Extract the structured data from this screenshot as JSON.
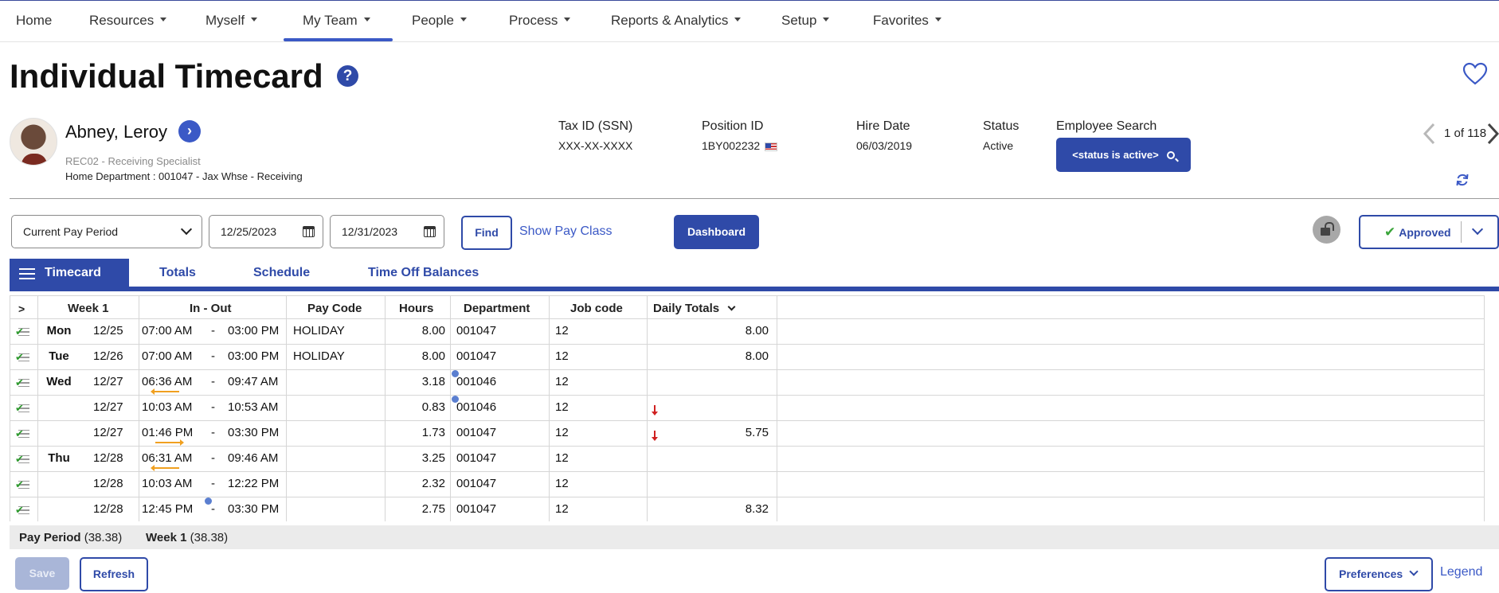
{
  "nav": {
    "items": [
      {
        "label": "Home",
        "dropdown": false
      },
      {
        "label": "Resources",
        "dropdown": true
      },
      {
        "label": "Myself",
        "dropdown": true
      },
      {
        "label": "My Team",
        "dropdown": true,
        "active": true
      },
      {
        "label": "People",
        "dropdown": true
      },
      {
        "label": "Process",
        "dropdown": true
      },
      {
        "label": "Reports & Analytics",
        "dropdown": true
      },
      {
        "label": "Setup",
        "dropdown": true
      },
      {
        "label": "Favorites",
        "dropdown": true
      }
    ]
  },
  "page": {
    "title": "Individual Timecard",
    "help_icon": "?"
  },
  "employee": {
    "name": "Abney, Leroy",
    "go_icon": "›",
    "position": "REC02 - Receiving Specialist",
    "home_department": "Home Department : 001047 - Jax Whse - Receiving",
    "tax_id_label": "Tax ID (SSN)",
    "tax_id_value": "XXX-XX-XXXX",
    "position_id_label": "Position ID",
    "position_id_value": "1BY002232",
    "hire_date_label": "Hire Date",
    "hire_date_value": "06/03/2019",
    "status_label": "Status",
    "status_value": "Active",
    "search_label": "Employee Search",
    "search_button": "<status is active>",
    "pager": "1 of 118"
  },
  "filters": {
    "period": "Current Pay Period",
    "start_date": "12/25/2023",
    "end_date": "12/31/2023",
    "find": "Find",
    "show_pay_class": "Show Pay Class",
    "dashboard": "Dashboard",
    "approved": "Approved"
  },
  "tabs": {
    "timecard": "Timecard",
    "totals": "Totals",
    "schedule": "Schedule",
    "time_off_balances": "Time Off Balances"
  },
  "table": {
    "headers": {
      "expand": ">",
      "week": "Week 1",
      "in_out": "In - Out",
      "pay_code": "Pay Code",
      "hours": "Hours",
      "department": "Department",
      "job_code": "Job code",
      "daily_totals": "Daily Totals"
    },
    "rows": [
      {
        "day": "Mon",
        "date": "12/25",
        "in": "07:00 AM",
        "sep": "-",
        "out": "03:00 PM",
        "pay_code": "HOLIDAY",
        "hours": "8.00",
        "department": "001047",
        "job_code": "12",
        "daily_total": "8.00"
      },
      {
        "day": "Tue",
        "date": "12/26",
        "in": "07:00 AM",
        "sep": "-",
        "out": "03:00 PM",
        "pay_code": "HOLIDAY",
        "hours": "8.00",
        "department": "001047",
        "job_code": "12",
        "daily_total": "8.00"
      },
      {
        "day": "Wed",
        "date": "12/27",
        "in": "06:36 AM",
        "sep": "-",
        "out": "09:47 AM",
        "pay_code": "",
        "hours": "3.18",
        "department": "001046",
        "job_code": "12",
        "daily_total": ""
      },
      {
        "day": "",
        "date": "12/27",
        "in": "10:03 AM",
        "sep": "-",
        "out": "10:53 AM",
        "pay_code": "",
        "hours": "0.83",
        "department": "001046",
        "job_code": "12",
        "daily_total": ""
      },
      {
        "day": "",
        "date": "12/27",
        "in": "01:46 PM",
        "sep": "-",
        "out": "03:30 PM",
        "pay_code": "",
        "hours": "1.73",
        "department": "001047",
        "job_code": "12",
        "daily_total": "5.75"
      },
      {
        "day": "Thu",
        "date": "12/28",
        "in": "06:31 AM",
        "sep": "-",
        "out": "09:46 AM",
        "pay_code": "",
        "hours": "3.25",
        "department": "001047",
        "job_code": "12",
        "daily_total": ""
      },
      {
        "day": "",
        "date": "12/28",
        "in": "10:03 AM",
        "sep": "-",
        "out": "12:22 PM",
        "pay_code": "",
        "hours": "2.32",
        "department": "001047",
        "job_code": "12",
        "daily_total": ""
      },
      {
        "day": "",
        "date": "12/28",
        "in": "12:45 PM",
        "sep": "-",
        "out": "03:30 PM",
        "pay_code": "",
        "hours": "2.75",
        "department": "001047",
        "job_code": "12",
        "daily_total": "8.32"
      }
    ]
  },
  "summary": {
    "pay_period_label": "Pay Period",
    "pay_period_value": "(38.38)",
    "week_label": "Week 1",
    "week_value": "(38.38)"
  },
  "footer": {
    "save": "Save",
    "refresh": "Refresh",
    "preferences": "Preferences",
    "legend": "Legend"
  },
  "colors": {
    "brand_blue": "#2f4aa8",
    "link_blue": "#3b59c6",
    "approved_green": "#3aa53a",
    "edit_orange": "#f0a020",
    "alert_red": "#d02020"
  }
}
